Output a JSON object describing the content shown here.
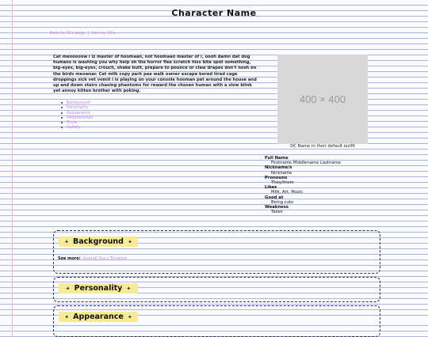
{
  "page": {
    "title": "Character Name"
  },
  "nav": {
    "back_link": "Back to OCs page",
    "separator": "|",
    "other_link": "See my OCs"
  },
  "intro": {
    "text": "Cat meooooow i iz master of hoomaan, not hoomaan master of i, oooh damn dat dog humans is washing you why help oh the horror flee scratch hiss bite spot something, big-eyes, big-eyes, crouch, shake butt, prepare to pounce or claw drapes don't nosh on the birds meowsar. Cat milk copy park pee walk owner escape bored tired cage droppings sick vet vomit i is playing on your console hooman pet around the house and up and down stairs chasing phantoms for reward the chosen human with a slow blink yet annoy kitten brother with poking."
  },
  "toc": [
    "Background",
    "Personality",
    "Appearance",
    "Relationships",
    "Trivia",
    "Gallery"
  ],
  "image": {
    "placeholder": "400 × 400",
    "caption": "OC Name in their default outfit"
  },
  "info": [
    {
      "label": "Full Name",
      "value": "Firstname Middlename Lastname"
    },
    {
      "label": "Nickname/s",
      "value": "Nickname"
    },
    {
      "label": "Pronouns",
      "value": "They/them"
    },
    {
      "label": "Likes",
      "value": "Milk, Art, Music"
    },
    {
      "label": "Good at",
      "value": "Being cute"
    },
    {
      "label": "Weakness",
      "value": "Taxes"
    }
  ],
  "sections": [
    {
      "title": "Background",
      "see_more_label": "See more:",
      "see_more_link": "Overall Story Timeline"
    },
    {
      "title": "Personality"
    },
    {
      "title": "Appearance"
    }
  ],
  "colors": {
    "link": "#c48bd6",
    "heading_bg": "#f8eb96",
    "rule_line": "#a9b6e8",
    "margin_line": "#f2b8c6"
  }
}
